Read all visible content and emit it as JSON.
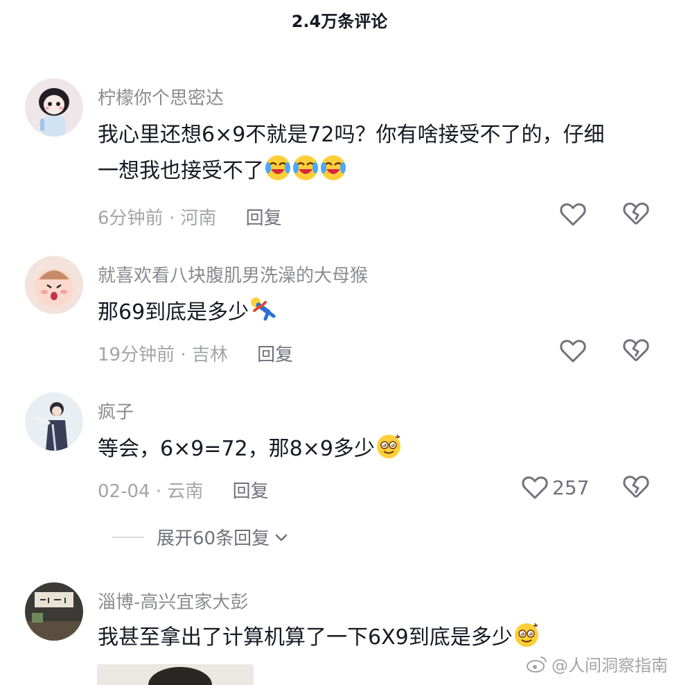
{
  "header": {
    "title": "2.4万条评论"
  },
  "comments": [
    {
      "username": "柠檬你个思密达",
      "text_lines": [
        "我心里还想6×9不就是72吗？你有啥接受不了的，仔细",
        "一想我也接受不了"
      ],
      "emoji": "laughing-crying-emoji",
      "time": "6分钟前",
      "location": "河南",
      "reply_label": "回复",
      "likes": ""
    },
    {
      "username": "就喜欢看八块腹肌男洗澡的大母猴",
      "text_lines": [
        "那69到底是多少"
      ],
      "emoji": "falling-person-emoji",
      "time": "19分钟前",
      "location": "吉林",
      "reply_label": "回复",
      "likes": ""
    },
    {
      "username": "疯子",
      "text_lines": [
        "等会，6×9=72，那8×9多少"
      ],
      "emoji": "dizzy-face-emoji",
      "time": "02-04",
      "location": "云南",
      "reply_label": "回复",
      "likes": "257"
    },
    {
      "username": "淄博-高兴宜家大彭",
      "text_lines": [
        "我甚至拿出了计算机算了一下6X9到底是多少"
      ],
      "emoji": "dizzy-face-emoji"
    }
  ],
  "expand_replies": {
    "label": "展开60条回复"
  },
  "separator": "·",
  "watermark": {
    "text": "@人间洞察指南"
  },
  "colors": {
    "text": "#161823",
    "meta": "#a3a4aa",
    "username": "#8a8b91",
    "icon": "#70717a"
  }
}
